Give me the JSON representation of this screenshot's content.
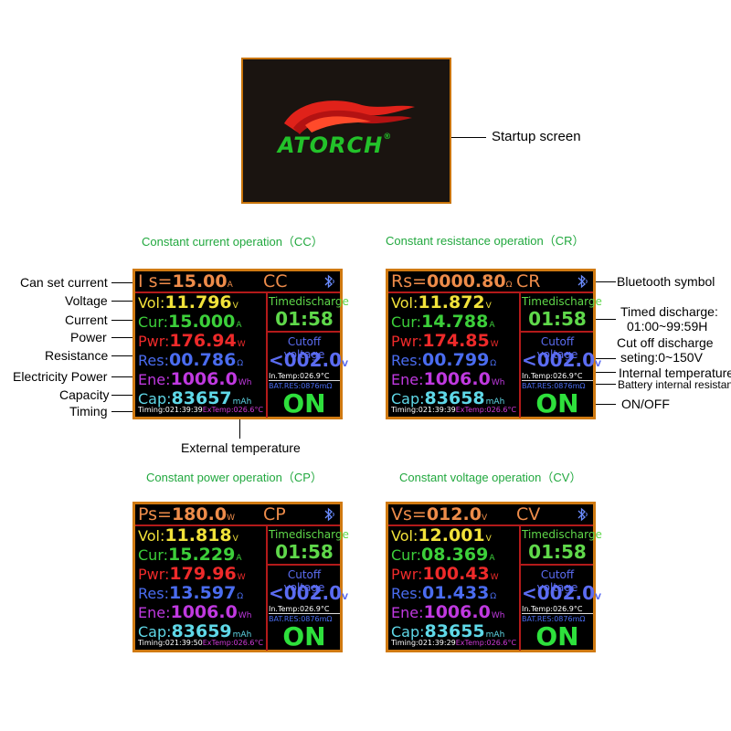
{
  "startup": {
    "logo_text": "ATORCH",
    "trademark": "®",
    "callout": "Startup screen"
  },
  "titles": {
    "cc": "Constant current operation（CC）",
    "cr": "Constant resistance operation（CR）",
    "cp": "Constant power operation（CP）",
    "cv": "Constant voltage operation（CV）"
  },
  "callouts_left": {
    "set_current": "Can set current",
    "voltage": "Voltage",
    "current": "Current",
    "power": "Power",
    "resistance": "Resistance",
    "energy": "Electricity Power",
    "capacity": "Capacity",
    "timing": "Timing",
    "ext_temp": "External temperature"
  },
  "callouts_right": {
    "bluetooth": "Bluetooth symbol",
    "timed_1": "Timed discharge:",
    "timed_2": "01:00~99:59H",
    "cutoff_1": "Cut off discharge",
    "cutoff_2": "seting:0~150V",
    "int_temp": "Internal temperature",
    "bat_res": "Battery internal resistance",
    "onoff": "ON/OFF"
  },
  "labels": {
    "vol": "Vol:",
    "cur": "Cur:",
    "pwr": "Pwr:",
    "res": "Res:",
    "ene": "Ene:",
    "cap": "Cap:",
    "timed": "Timedischarge",
    "cutoff": "Cutoff voltage",
    "unit_v": "V",
    "unit_a": "A",
    "unit_w": "W",
    "unit_ohm": "Ω",
    "unit_wh": "Wh",
    "unit_mah": "mAh"
  },
  "screens": {
    "cc": {
      "set_label": "I s=",
      "set_value": "15.00",
      "set_unit": "A",
      "mode": "CC",
      "vol": "11.796",
      "cur": "15.000",
      "pwr": "176.94",
      "res": "00.786",
      "ene": "1006.0",
      "cap": "83657",
      "timed": "01:58",
      "cutoff": "<002.0",
      "intemp": "In.Temp:026.9°C",
      "batres": "BAT.RES:0876mΩ",
      "onoff": "ON",
      "timing": "Timing:021:39:39",
      "ext": "ExTemp:026.6°C"
    },
    "cr": {
      "set_label": "Rs=",
      "set_value": "0000.80",
      "set_unit": "Ω",
      "mode": "CR",
      "vol": "11.872",
      "cur": "14.788",
      "pwr": "174.85",
      "res": "00.799",
      "ene": "1006.0",
      "cap": "83658",
      "timed": "01:58",
      "cutoff": "<002.0",
      "intemp": "In.Temp:026.9°C",
      "batres": "BAT.RES:0876mΩ",
      "onoff": "ON",
      "timing": "Timing:021:39:39",
      "ext": "ExTemp:026.6°C"
    },
    "cp": {
      "set_label": "Ps=",
      "set_value": "180.0",
      "set_unit": "W",
      "mode": "CP",
      "vol": "11.818",
      "cur": "15.229",
      "pwr": "179.96",
      "res": "13.597",
      "ene": "1006.0",
      "cap": "83659",
      "timed": "01:58",
      "cutoff": "<002.0",
      "intemp": "In.Temp:026.9°C",
      "batres": "BAT.RES:0876mΩ",
      "onoff": "ON",
      "timing": "Timing:021:39:50",
      "ext": "ExTemp:026.6°C"
    },
    "cv": {
      "set_label": "Vs=",
      "set_value": "012.0",
      "set_unit": "V",
      "mode": "CV",
      "vol": "12.001",
      "cur": "08.369",
      "pwr": "100.43",
      "res": "01.433",
      "ene": "1006.0",
      "cap": "83655",
      "timed": "01:58",
      "cutoff": "<002.0",
      "intemp": "In.Temp:026.9°C",
      "batres": "BAT.RES:0876mΩ",
      "onoff": "ON",
      "timing": "Timing:021:39:29",
      "ext": "ExTemp:026.6°C"
    }
  },
  "colors": {
    "border": "#d07a12",
    "header": "#ee8c4a",
    "vol": "#f2e23a",
    "cur": "#3ccf3a",
    "pwr": "#ee2a2a",
    "res": "#4a6cf0",
    "ene": "#c039e0",
    "cap": "#5fd8e8",
    "on": "#2ee03c",
    "title": "#21a83e"
  }
}
